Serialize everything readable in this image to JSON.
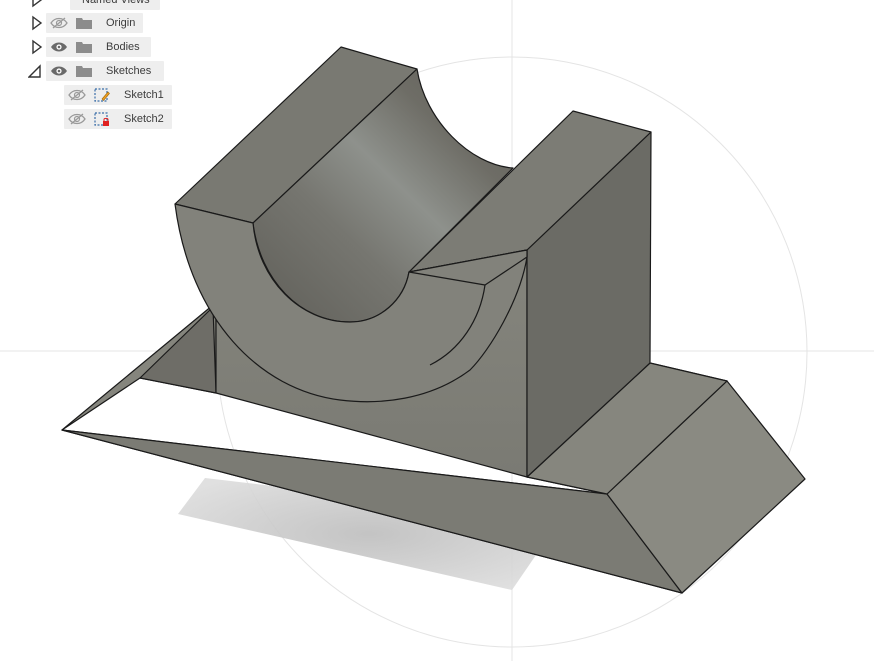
{
  "browser": {
    "items": [
      {
        "label": "Named Views",
        "expanded": false,
        "visible": null,
        "icon": "folder-icon"
      },
      {
        "label": "Origin",
        "expanded": false,
        "visible": false,
        "icon": "folder-icon"
      },
      {
        "label": "Bodies",
        "expanded": false,
        "visible": true,
        "icon": "folder-icon"
      },
      {
        "label": "Sketches",
        "expanded": true,
        "visible": true,
        "icon": "folder-icon"
      }
    ],
    "sketches": [
      {
        "label": "Sketch1",
        "visible": false,
        "icon": "sketch-icon"
      },
      {
        "label": "Sketch2",
        "visible": false,
        "icon": "sketch-error-icon"
      }
    ]
  },
  "colors": {
    "body_face_light": "#8b8b83",
    "body_face_mid": "#7c7c74",
    "body_face_dark": "#5f5f59",
    "edge": "#1a1a1a",
    "shadow": "#c8c8c8",
    "chip_bg": "#eeeeee",
    "sketch_warning": "#f0a020",
    "sketch_error": "#e02020"
  }
}
